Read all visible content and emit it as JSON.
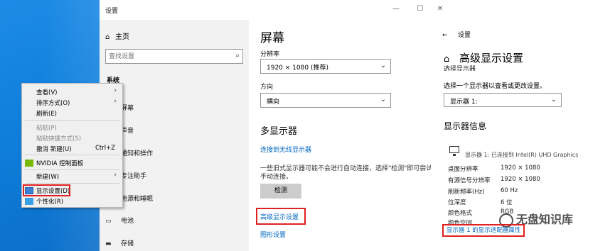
{
  "settings_window": {
    "title": "设置",
    "controls": {
      "minimize": "—",
      "maximize": "☐",
      "close": "✕"
    }
  },
  "nav": {
    "home": "主页",
    "search_placeholder": "查找设置",
    "section": "系统",
    "items": [
      {
        "label": "屏幕",
        "icon": "monitor-icon"
      },
      {
        "label": "声音",
        "icon": "speaker-icon"
      },
      {
        "label": "通知和操作",
        "icon": "notification-icon"
      },
      {
        "label": "专注助手",
        "icon": "moon-icon"
      },
      {
        "label": "电源和睡眠",
        "icon": "power-icon"
      },
      {
        "label": "电池",
        "icon": "battery-icon"
      },
      {
        "label": "存储",
        "icon": "storage-icon"
      }
    ]
  },
  "screen": {
    "title": "屏幕",
    "resolution_label": "分辨率",
    "resolution_value": "1920 × 1080 (推荐)",
    "orientation_label": "方向",
    "orientation_value": "横向",
    "multi_title": "多显示器",
    "wireless_link": "连接到无线显示器",
    "description": "一些旧式显示器可能不会进行自动连接，选择\"检测\"即可尝试手动连接。",
    "detect_button": "检测",
    "advanced_link": "高级显示设置",
    "graphics_link": "图形设置"
  },
  "advanced": {
    "back_label": "设置",
    "title": "高级显示设置",
    "cutoff_text": "选择显示器",
    "select_label": "选择一个显示器以查看或更改设置。",
    "select_value": "显示器 1:",
    "info_title": "显示器信息",
    "monitor_desc": "显示器 1: 已连接到 Intel(R) UHD Graphics",
    "rows": [
      {
        "k": "桌面分辨率",
        "v": "1920 × 1080"
      },
      {
        "k": "有源信号分辨率",
        "v": "1920 × 1080"
      },
      {
        "k": "刷新频率(Hz)",
        "v": "60 Hz"
      },
      {
        "k": "位深度",
        "v": "6 位"
      },
      {
        "k": "颜色格式",
        "v": "RGB"
      },
      {
        "k": "颜色空间",
        "v": ""
      }
    ],
    "adapter_link": "显示器 1 的显示适配器属性",
    "watermark": "无盘知识库"
  },
  "context_menu": {
    "items": [
      {
        "label": "查看(V)",
        "arrow": true,
        "disabled": false
      },
      {
        "label": "排序方式(O)",
        "arrow": true,
        "disabled": false
      },
      {
        "label": "刷新(E)",
        "arrow": false,
        "disabled": false
      },
      {
        "label": "粘贴(P)",
        "arrow": false,
        "disabled": true
      },
      {
        "label": "粘贴快捷方式(S)",
        "arrow": false,
        "disabled": true
      },
      {
        "label": "撤消 新建(U)",
        "shortcut": "Ctrl+Z",
        "arrow": false,
        "disabled": false
      },
      {
        "label": "NVIDIA 控制面板",
        "arrow": false,
        "disabled": false
      },
      {
        "label": "新建(W)",
        "arrow": true,
        "disabled": false
      },
      {
        "label": "显示设置(D)",
        "arrow": false,
        "disabled": false
      },
      {
        "label": "个性化(R)",
        "arrow": false,
        "disabled": false
      }
    ]
  }
}
